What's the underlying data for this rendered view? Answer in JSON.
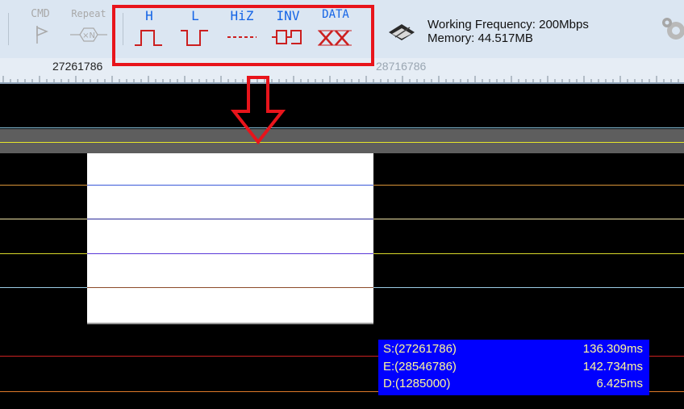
{
  "toolbar": {
    "cmd_label": "CMD",
    "repeat_label": "Repeat",
    "repeat_icon_text": "×N",
    "h_label": "H",
    "l_label": "L",
    "hiz_label": "HiZ",
    "inv_label": "INV",
    "data_label": "DATA",
    "freq_line1": "Working Frequency: 200Mbps",
    "freq_line2": "Memory: 44.517MB"
  },
  "ruler": {
    "left_tick": "27261786",
    "right_tick": "28716786"
  },
  "info": {
    "s_key": "S:(27261786)",
    "s_val": "136.309ms",
    "e_key": "E:(28546786)",
    "e_val": "142.734ms",
    "d_key": "D:(1285000)",
    "d_val": "6.425ms"
  },
  "colors": {
    "accent_red": "#e8141b",
    "toolbar_blue": "#1565e6",
    "info_bg": "#0000ff",
    "info_text": "#fff79a"
  }
}
